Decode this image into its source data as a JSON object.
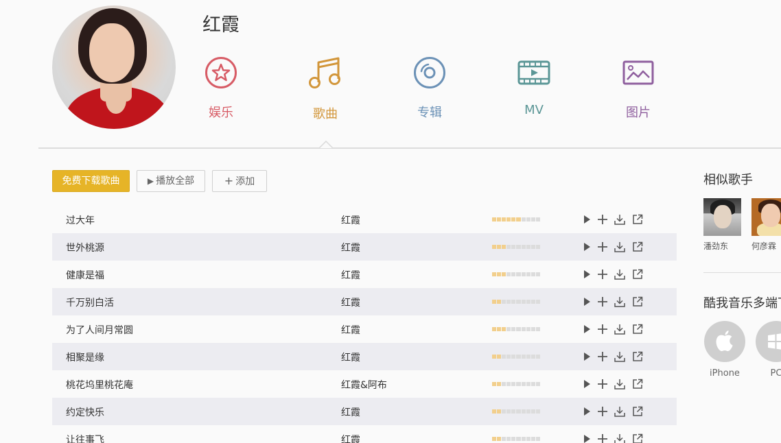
{
  "artist": {
    "name": "红霞"
  },
  "nav": [
    {
      "label": "娱乐",
      "icon": "star-icon",
      "color": "#d75b65"
    },
    {
      "label": "歌曲",
      "icon": "music-note-icon",
      "color": "#d2963a"
    },
    {
      "label": "专辑",
      "icon": "disc-icon",
      "color": "#6b91b6"
    },
    {
      "label": "MV",
      "icon": "film-icon",
      "color": "#5b9696"
    },
    {
      "label": "图片",
      "icon": "image-icon",
      "color": "#8f5f9e"
    }
  ],
  "active_tab": "歌曲",
  "toolbar": {
    "download_label": "免费下载歌曲",
    "play_all_label": "播放全部",
    "add_label": "添加",
    "accent_color": "#e6b427"
  },
  "songs": [
    {
      "title": "过大年",
      "artist": "红霞",
      "popularity": 0.6
    },
    {
      "title": "世外桃源",
      "artist": "红霞",
      "popularity": 0.3
    },
    {
      "title": "健康是福",
      "artist": "红霞",
      "popularity": 0.3
    },
    {
      "title": "千万别白活",
      "artist": "红霞",
      "popularity": 0.2
    },
    {
      "title": "为了人间月常圆",
      "artist": "红霞",
      "popularity": 0.3
    },
    {
      "title": "相聚是缘",
      "artist": "红霞",
      "popularity": 0.2
    },
    {
      "title": "桃花坞里桃花庵",
      "artist": "红霞&阿布",
      "popularity": 0.2
    },
    {
      "title": "约定快乐",
      "artist": "红霞",
      "popularity": 0.2
    },
    {
      "title": "让往事飞",
      "artist": "红霞",
      "popularity": 0.2
    }
  ],
  "similar": {
    "title": "相似歌手",
    "artists": [
      {
        "name": "潘劲东"
      },
      {
        "name": "何彦霖"
      }
    ]
  },
  "multi_platform": {
    "title": "酷我音乐多端下",
    "platforms": [
      {
        "name": "iPhone",
        "icon": "apple-icon"
      },
      {
        "name": "PC",
        "icon": "windows-icon"
      }
    ]
  }
}
